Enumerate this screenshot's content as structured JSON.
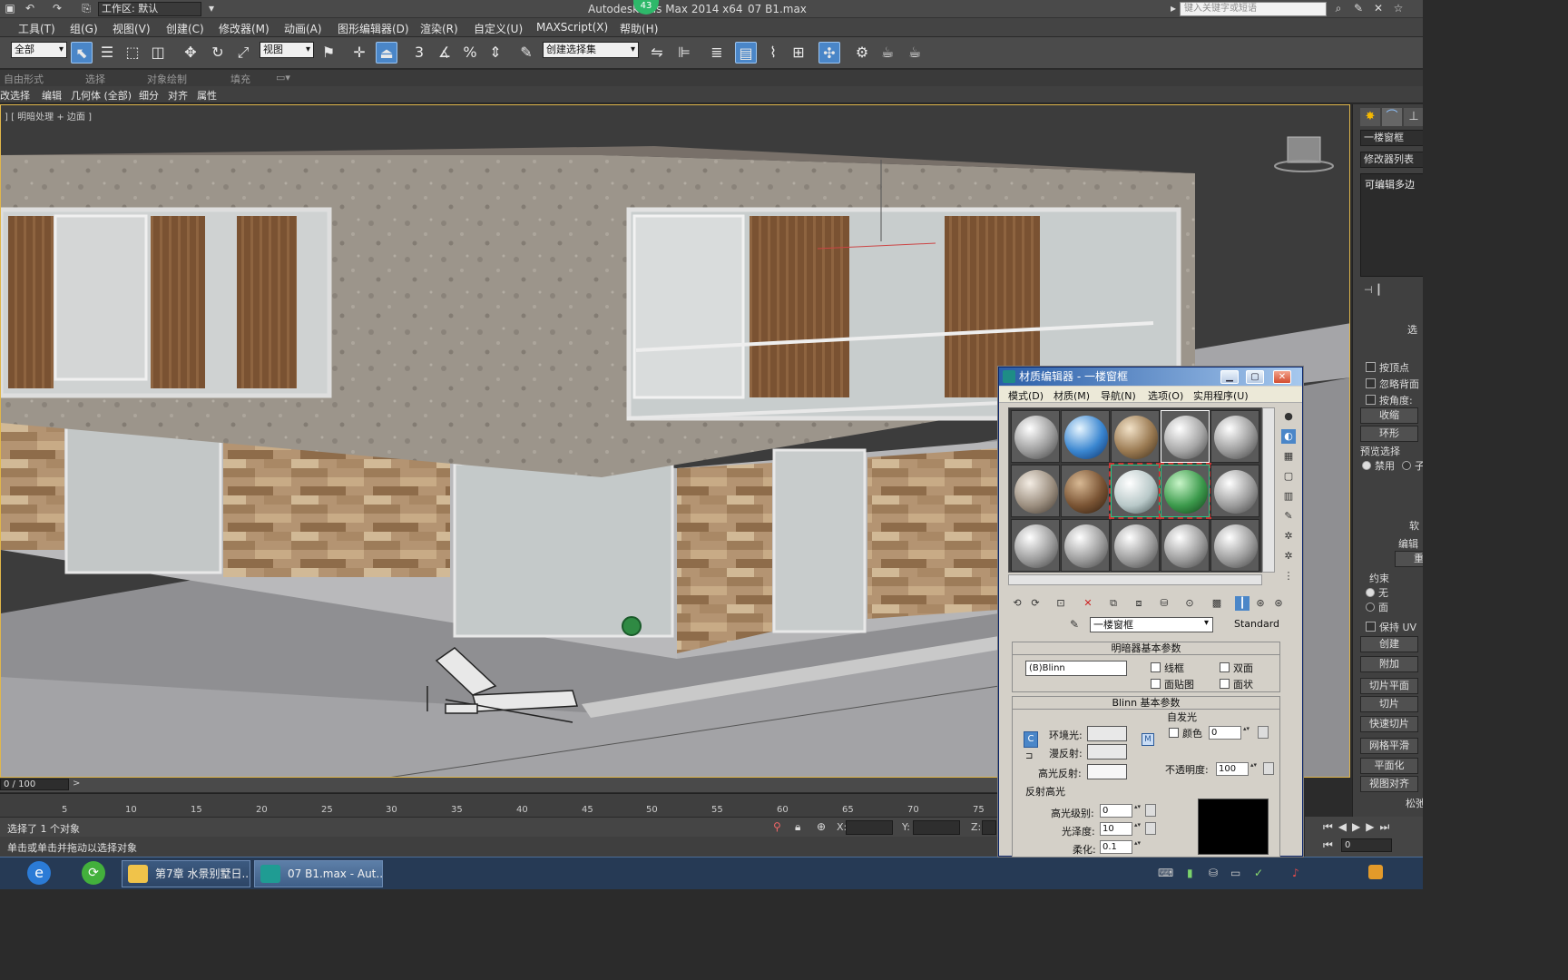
{
  "title": {
    "workspace": "工作区: 默认",
    "app": "Autodesk 3ds Max  2014 x64",
    "file": "07 B1.max",
    "badge": "43",
    "search_placeholder": "键入关键字或短语"
  },
  "menu": [
    "工具(T)",
    "组(G)",
    "视图(V)",
    "创建(C)",
    "修改器(M)",
    "动画(A)",
    "图形编辑器(D)",
    "渲染(R)",
    "自定义(U)",
    "MAXScript(X)",
    "帮助(H)"
  ],
  "toolbar": {
    "filter": "全部",
    "refcoord": "视图",
    "selset": "创建选择集",
    "snap_labels": [
      "3",
      "%"
    ]
  },
  "ribbon": {
    "tabs": [
      "自由形式",
      "选择",
      "对象绘制",
      "填充"
    ],
    "subtabs": [
      "改选择",
      "编辑",
      "几何体 (全部)",
      "细分",
      "对齐",
      "属性"
    ]
  },
  "viewport": {
    "label": "] [ 明暗处理 + 边面 ]",
    "border_color": "#e0b64a"
  },
  "right_panel": {
    "object_name": "一楼窗框",
    "modifier_list": "修改器列表",
    "stack_item": "可编辑多边",
    "section_select": "选",
    "cb_by_vertex": "按顶点",
    "cb_ignore_back": "忽略背面",
    "cb_by_angle": "按角度:",
    "btn_shrink": "收缩",
    "btn_ring": "环形",
    "preview_label": "预览选择",
    "radio_disable": "禁用",
    "radio_sub": "子",
    "soft_sel": "软",
    "edit_label": "编辑",
    "btn_repeat": "重复",
    "constraints": "约束",
    "radio_none": "无",
    "radio_face": "面",
    "cb_keep_uv": "保持 UV",
    "btn_create": "创建",
    "btn_attach": "附加",
    "btn_slice_plane": "切片平面",
    "btn_slice": "切片",
    "btn_quickslice": "快速切片",
    "btn_meshsmooth": "网格平滑",
    "btn_planarize": "平面化",
    "btn_viewalign": "视图对齐",
    "relax": "松弛"
  },
  "timeline": {
    "frame": "0 / 100",
    "ticks": [
      "5",
      "10",
      "15",
      "20",
      "25",
      "30",
      "35",
      "40",
      "45",
      "50",
      "55",
      "60",
      "65",
      "70",
      "75"
    ]
  },
  "status": {
    "line1": "选择了 1 个对象",
    "line2": "单击或单击并拖动以选择对象",
    "x_label": "X:",
    "y_label": "Y:",
    "z_label": "Z:",
    "frame_field": "0"
  },
  "material_editor": {
    "title": "材质编辑器 - 一楼窗框",
    "menu": [
      "模式(D)",
      "材质(M)",
      "导航(N)",
      "选项(O)",
      "实用程序(U)"
    ],
    "material_name": "一楼窗框",
    "material_type": "Standard",
    "shader_rollout": "明暗器基本参数",
    "shader": "(B)Blinn",
    "cb_wire": "线框",
    "cb_2sided": "双面",
    "cb_facemap": "面贴图",
    "cb_faceted": "面状",
    "blinn_rollout": "Blinn 基本参数",
    "self_illum": "自发光",
    "cb_color": "颜色",
    "self_illum_value": "0",
    "ambient": "环境光:",
    "diffuse": "漫反射:",
    "specular": "高光反射:",
    "opacity_label": "不透明度:",
    "opacity_value": "100",
    "spec_highlights": "反射高光",
    "spec_level_label": "高光级别:",
    "spec_level": "0",
    "gloss_label": "光泽度:",
    "gloss": "10",
    "soften_label": "柔化:",
    "soften": "0.1"
  },
  "taskbar": {
    "apps": [
      "第7章 水景别墅日...",
      "07 B1.max - Aut..."
    ]
  }
}
